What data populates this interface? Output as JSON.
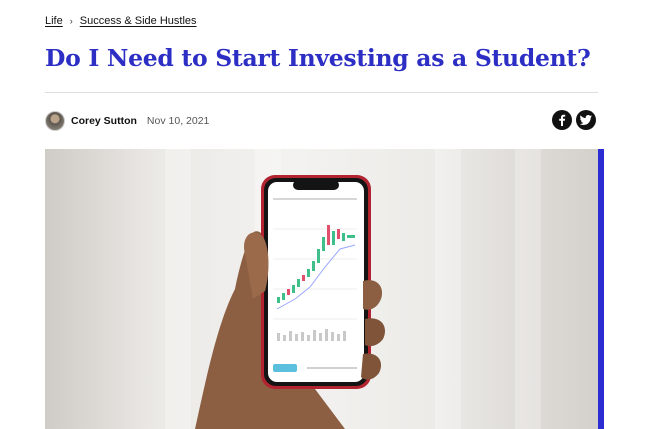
{
  "breadcrumb": {
    "items": [
      "Life",
      "Success & Side Hustles"
    ],
    "separator": "›"
  },
  "article": {
    "title": "Do I Need to Start Investing as a Student?",
    "author": "Corey Sutton",
    "date": "Nov 10, 2021"
  },
  "share": {
    "icons": [
      "facebook-icon",
      "twitter-icon"
    ]
  },
  "colors": {
    "title": "#2d2fc4",
    "hero_shadow": "#2b2dd2",
    "candle_up": "#3fbf8a",
    "candle_down": "#e0506a"
  }
}
